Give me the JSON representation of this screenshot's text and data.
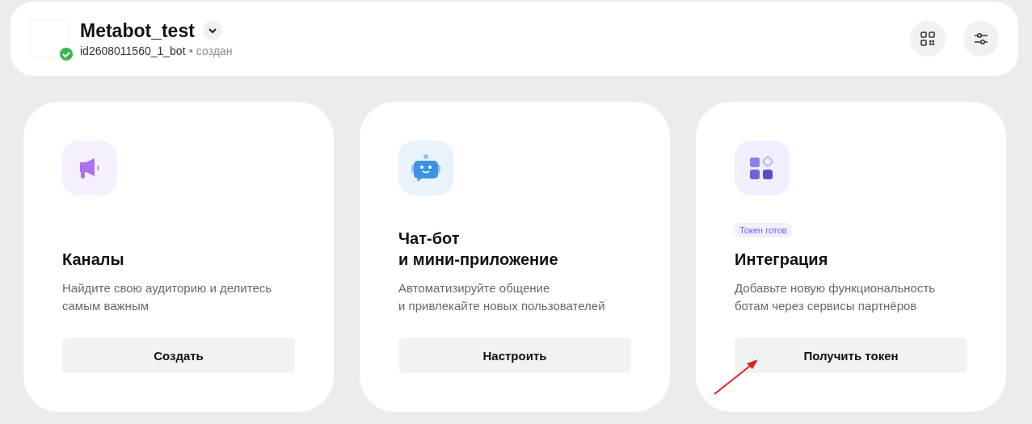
{
  "header": {
    "title": "Metabot_test",
    "bot_id": "id2608011560_1_bot",
    "status": "• создан",
    "verified": true
  },
  "cards": [
    {
      "kind": "megaphone",
      "title": [
        "Каналы"
      ],
      "description": [
        "Найдите свою аудиторию и делитесь",
        "самым важным"
      ],
      "button": "Создать"
    },
    {
      "kind": "robot",
      "title": [
        "Чат-бот",
        "и мини-приложение"
      ],
      "description": [
        "Автоматизируйте общение",
        "и привлекайте новых пользователей"
      ],
      "button": "Настроить"
    },
    {
      "kind": "apps",
      "badge": "Токен готов",
      "title": [
        "Интеграция"
      ],
      "description": [
        "Добавьте новую функциональность",
        "ботам через сервисы партнёров"
      ],
      "button": "Получить токен"
    }
  ]
}
